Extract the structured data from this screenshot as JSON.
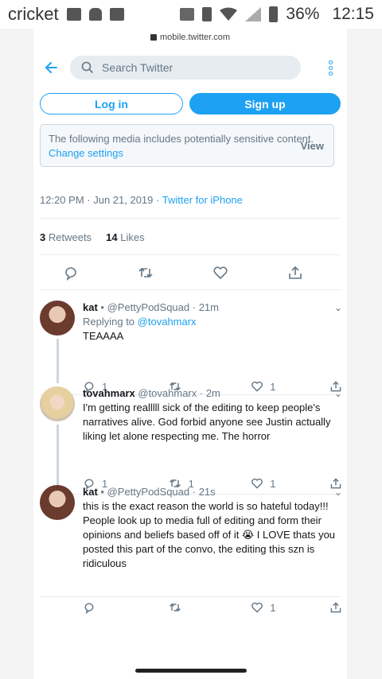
{
  "status_bar": {
    "carrier": "cricket",
    "battery": "36%",
    "time": "12:15"
  },
  "browser": {
    "url": "mobile.twitter.com"
  },
  "nav": {
    "search_placeholder": "Search Twitter"
  },
  "auth": {
    "login_label": "Log in",
    "signup_label": "Sign up"
  },
  "sensitive": {
    "text": "The following media includes potentially sensitive content.",
    "link": "Change settings",
    "view": "View"
  },
  "tweet_meta": {
    "time": "12:20 PM",
    "date": "Jun 21, 2019",
    "source": "Twitter for iPhone"
  },
  "stats": {
    "retweets_count": "3",
    "retweets_label": "Retweets",
    "likes_count": "14",
    "likes_label": "Likes"
  },
  "replies": [
    {
      "name": "kat",
      "handle": "@PettyPodSquad",
      "time": "21m",
      "replying_to_label": "Replying to",
      "replying_to": "@tovahmarx",
      "text": "TEAAAA",
      "reply_count": "1",
      "retweet_count": "",
      "like_count": "1"
    },
    {
      "name": "tovahmarx",
      "handle": "@tovahmarx",
      "time": "2m",
      "text": "I'm getting realllll sick of the editing to keep people's narratives alive. God forbid anyone see Justin actually liking let alone respecting me. The horror",
      "reply_count": "1",
      "retweet_count": "1",
      "like_count": "1"
    },
    {
      "name": "kat",
      "handle": "@PettyPodSquad",
      "time": "21s",
      "text": "this is the exact reason the world is so hateful today!!! People look up to media full of editing and form their opinions and beliefs based off of it 😭 I LOVE thats you posted this part of the convo, the editing this szn is ridiculous",
      "reply_count": "",
      "retweet_count": "",
      "like_count": "1"
    }
  ],
  "colors": {
    "accent": "#1da1f2",
    "muted": "#657786",
    "divider": "#e6ecf0"
  }
}
